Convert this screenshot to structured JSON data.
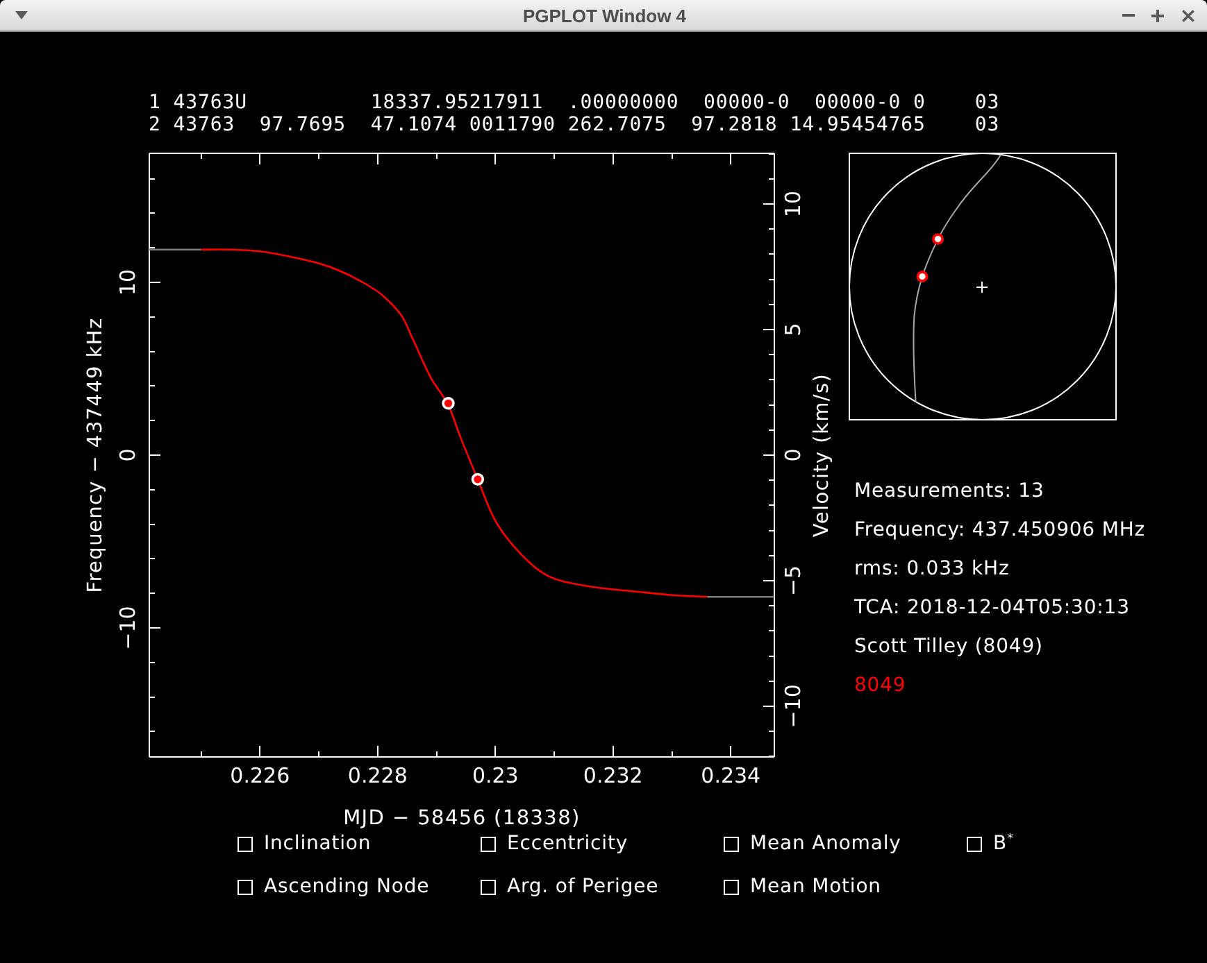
{
  "window": {
    "title": "PGPLOT Window 4"
  },
  "tle": {
    "lines": [
      "1 43763U          18337.95217911  .00000000  00000-0  00000-0 0    03",
      "2 43763  97.7695  47.1074 0011790 262.7075  97.2818 14.95454765    03"
    ]
  },
  "frequency_plot": {
    "chart_data": {
      "type": "line",
      "xlabel": "MJD − 58456 (18338)",
      "ylabel": "Frequency − 437449 kHz",
      "y2label": "Velocity (km/s)",
      "x": [
        0.22412,
        0.2245,
        0.225,
        0.2255,
        0.226,
        0.2265,
        0.227,
        0.2274,
        0.2278,
        0.2281,
        0.2284,
        0.2286,
        0.2289,
        0.2292,
        0.2294,
        0.2297,
        0.23,
        0.2304,
        0.2309,
        0.2316,
        0.2324,
        0.233,
        0.2336,
        0.234,
        0.23474
      ],
      "series": [
        {
          "color": "#7f7f7f",
          "values": [
            11.9,
            11.9,
            11.9,
            null,
            null,
            null,
            null,
            null,
            null,
            null,
            null,
            null,
            null,
            null,
            null,
            null,
            null,
            null,
            null,
            null,
            null,
            null,
            -8.2,
            -8.2,
            -8.2
          ]
        },
        {
          "color": "#ff0000",
          "values": [
            null,
            null,
            11.9,
            11.9,
            11.8,
            11.5,
            11.1,
            10.6,
            9.9,
            9.2,
            8.1,
            6.7,
            4.5,
            2.9,
            1.1,
            -1.4,
            -3.8,
            -5.6,
            -7.0,
            -7.6,
            -7.9,
            -8.1,
            -8.2,
            null,
            null
          ]
        },
        {
          "type": "scatter",
          "color": "#ff0000",
          "values": [
            null,
            null,
            null,
            null,
            null,
            null,
            null,
            null,
            null,
            null,
            null,
            null,
            null,
            3.0,
            null,
            -1.4,
            null,
            null,
            null,
            null,
            null,
            null,
            null,
            null,
            null
          ]
        }
      ],
      "xlim": [
        0.22412,
        0.23474
      ],
      "ylim": [
        -17.47,
        17.47
      ],
      "y2lim": [
        -12.02,
        12.02
      ],
      "xticks": [
        0.226,
        0.228,
        0.23,
        0.232,
        0.234
      ],
      "yticks": [
        {
          "value": -10,
          "label": "−10"
        },
        0,
        10
      ],
      "y2ticks": [
        {
          "value": -10,
          "label": "−10"
        },
        {
          "value": -5,
          "label": "−5"
        },
        0,
        5,
        10
      ]
    }
  },
  "info": [
    {
      "text": "Measurements: 13",
      "color": "#ffffff"
    },
    {
      "text": "Frequency: 437.450906 MHz",
      "color": "#ffffff"
    },
    {
      "text": "rms: 0.033 kHz",
      "color": "#ffffff"
    },
    {
      "text": "TCA: 2018-12-04T05:30:13",
      "color": "#ffffff"
    },
    {
      "text": "Scott Tilley (8049)",
      "color": "#ffffff"
    },
    {
      "text": "8049",
      "color": "#ff0000"
    }
  ],
  "options": [
    {
      "label": "Inclination",
      "checked": false
    },
    {
      "label": "Eccentricity",
      "checked": false
    },
    {
      "label": "Mean Anomaly",
      "checked": false
    },
    {
      "label": "B$^{*}$",
      "checked": false
    },
    {
      "label": "Ascending Node",
      "checked": false
    },
    {
      "label": "Arg. of Perigee",
      "checked": false
    },
    {
      "label": "Mean Motion",
      "checked": false
    }
  ]
}
